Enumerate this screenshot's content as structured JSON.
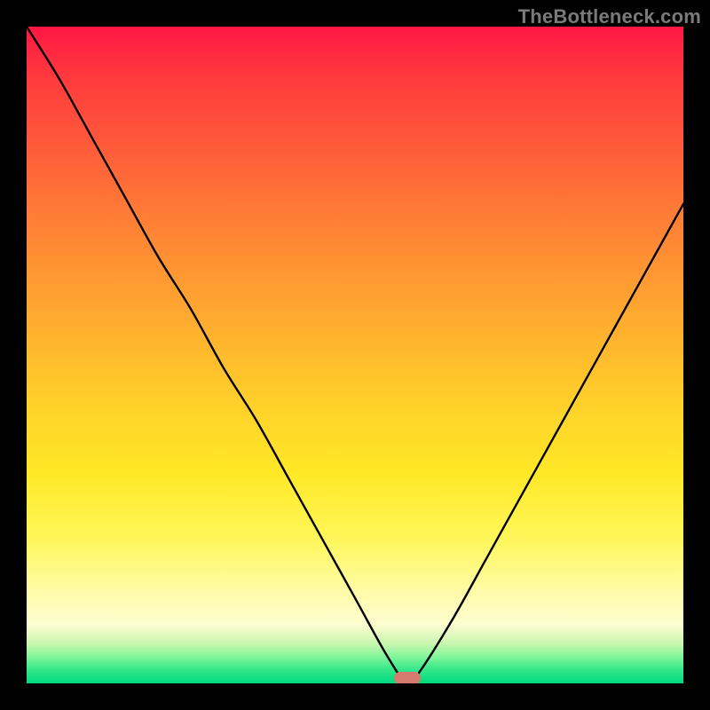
{
  "credit_text": "TheBottleneck.com",
  "chart_data": {
    "type": "line",
    "title": "",
    "xlabel": "",
    "ylabel": "",
    "xlim": [
      0,
      100
    ],
    "ylim": [
      0,
      100
    ],
    "grid": false,
    "x": [
      0,
      5,
      10,
      15,
      20,
      25,
      30,
      35,
      40,
      45,
      50,
      55,
      58,
      60,
      65,
      70,
      75,
      80,
      85,
      90,
      95,
      100
    ],
    "values": [
      100,
      92,
      83,
      74,
      65,
      57,
      48,
      40,
      31,
      22,
      13,
      4,
      0,
      2,
      10,
      19,
      28,
      37,
      46,
      55,
      64,
      73
    ],
    "minimum_x": 58,
    "marker": {
      "x": 58,
      "y": 0
    },
    "gradient_colors": {
      "top": "#ff1744",
      "mid": "#ffd22a",
      "bottom": "#00d97e"
    }
  }
}
